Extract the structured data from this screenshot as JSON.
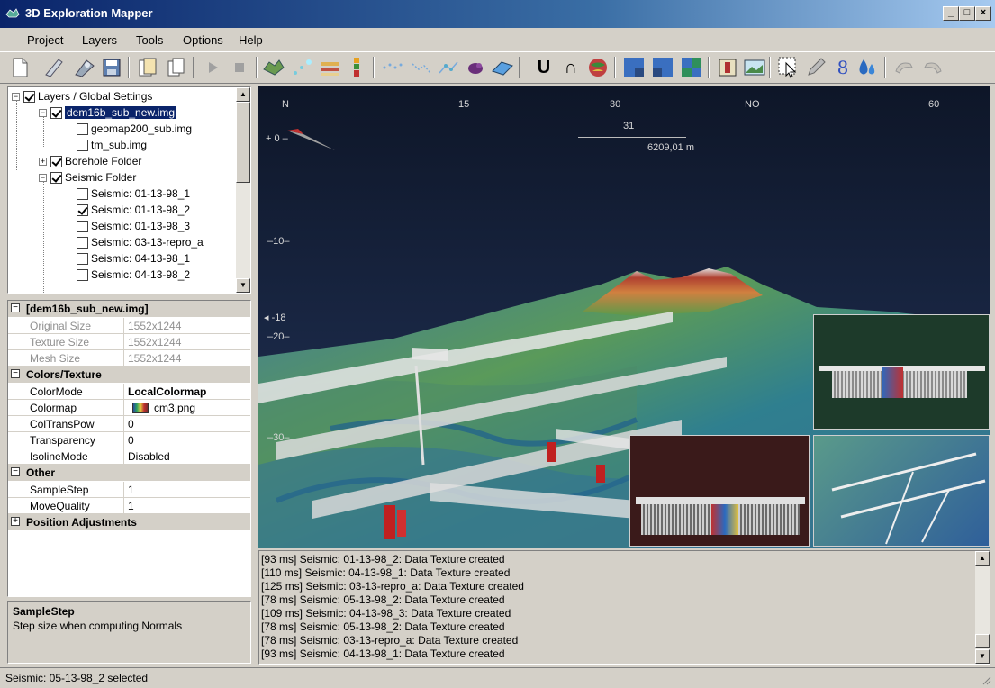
{
  "app": {
    "title": "3D Exploration Mapper"
  },
  "window_buttons": {
    "minimize": "_",
    "maximize": "□",
    "close": "×"
  },
  "menu": [
    {
      "label": "Project",
      "accel": "P"
    },
    {
      "label": "Layers",
      "accel": "L"
    },
    {
      "label": "Tools",
      "accel": "T"
    },
    {
      "label": "Options",
      "accel": "O"
    },
    {
      "label": "Help",
      "accel": "H"
    }
  ],
  "toolbar_icons": [
    "new-file-icon",
    "edit-icon",
    "wizard-icon",
    "save-icon",
    "import-icon",
    "copy-icon",
    "play-icon",
    "stop-icon",
    "terrain-icon",
    "points-icon",
    "stack-icon",
    "borehole-icon",
    "scatter-icon",
    "polyline-icon",
    "polyline-nodes-icon",
    "object-icon",
    "plane-icon",
    "u-icon",
    "n-icon",
    "globe-icon",
    "view-1-icon",
    "view-2-icon",
    "view-3-icon",
    "book-icon",
    "image-icon",
    "select-icon",
    "pencil-icon",
    "eight-icon",
    "drop-icon",
    "undo-icon",
    "redo-icon"
  ],
  "toolbar_text": {
    "u": "U",
    "n": "∩",
    "eight": "8"
  },
  "tree": {
    "items": [
      {
        "label": "Layers / Global Settings",
        "checked": true,
        "expander": "−"
      },
      {
        "label": "dem16b_sub_new.img",
        "checked": true,
        "expander": "−",
        "selected": true
      },
      {
        "label": "geomap200_sub.img",
        "checked": false
      },
      {
        "label": "tm_sub.img",
        "checked": false
      },
      {
        "label": "Borehole Folder",
        "checked": true,
        "expander": "+"
      },
      {
        "label": "Seismic Folder",
        "checked": true,
        "expander": "−"
      },
      {
        "label": "Seismic: 01-13-98_1",
        "checked": false
      },
      {
        "label": "Seismic: 01-13-98_2",
        "checked": true
      },
      {
        "label": "Seismic: 01-13-98_3",
        "checked": false
      },
      {
        "label": "Seismic: 03-13-repro_a",
        "checked": false
      },
      {
        "label": "Seismic: 04-13-98_1",
        "checked": false
      },
      {
        "label": "Seismic: 04-13-98_2",
        "checked": false
      }
    ]
  },
  "properties": {
    "header": "[dem16b_sub_new.img]",
    "rows_readonly": [
      {
        "k": "Original Size",
        "v": "1552x1244"
      },
      {
        "k": "Texture Size",
        "v": "1552x1244"
      },
      {
        "k": "Mesh Size",
        "v": "1552x1244"
      }
    ],
    "colors_header": "Colors/Texture",
    "colors_rows": [
      {
        "k": "ColorMode",
        "v": "LocalColormap"
      },
      {
        "k": "Colormap",
        "v": "cm3.png"
      },
      {
        "k": "ColTransPow",
        "v": "0"
      },
      {
        "k": "Transparency",
        "v": "0"
      },
      {
        "k": "IsolineMode",
        "v": "Disabled"
      }
    ],
    "other_header": "Other",
    "other_rows": [
      {
        "k": "SampleStep",
        "v": "1"
      },
      {
        "k": "MoveQuality",
        "v": "1"
      }
    ],
    "position_header": "Position Adjustments",
    "minus": "−",
    "plus": "+"
  },
  "description": {
    "title": "SampleStep",
    "text": "Step size when computing Normals"
  },
  "viewport": {
    "compass": [
      "N",
      "15",
      "30",
      "NO",
      "60"
    ],
    "heading": "31",
    "scale": "6209,01 m",
    "depths": [
      "+ 0 –",
      "–10–",
      "–20–",
      "–30–"
    ],
    "pitch": "◂ -18"
  },
  "log": [
    "[93 ms] Seismic: 01-13-98_2: Data Texture created",
    "[110 ms] Seismic: 04-13-98_1: Data Texture created",
    "[125 ms] Seismic: 03-13-repro_a: Data Texture created",
    "[78 ms] Seismic: 05-13-98_2: Data Texture created",
    "[109 ms] Seismic: 04-13-98_3: Data Texture created",
    "[78 ms] Seismic: 05-13-98_2: Data Texture created",
    "[78 ms] Seismic: 03-13-repro_a: Data Texture created",
    "[93 ms] Seismic: 04-13-98_1: Data Texture created"
  ],
  "status": "Seismic: 05-13-98_2 selected"
}
